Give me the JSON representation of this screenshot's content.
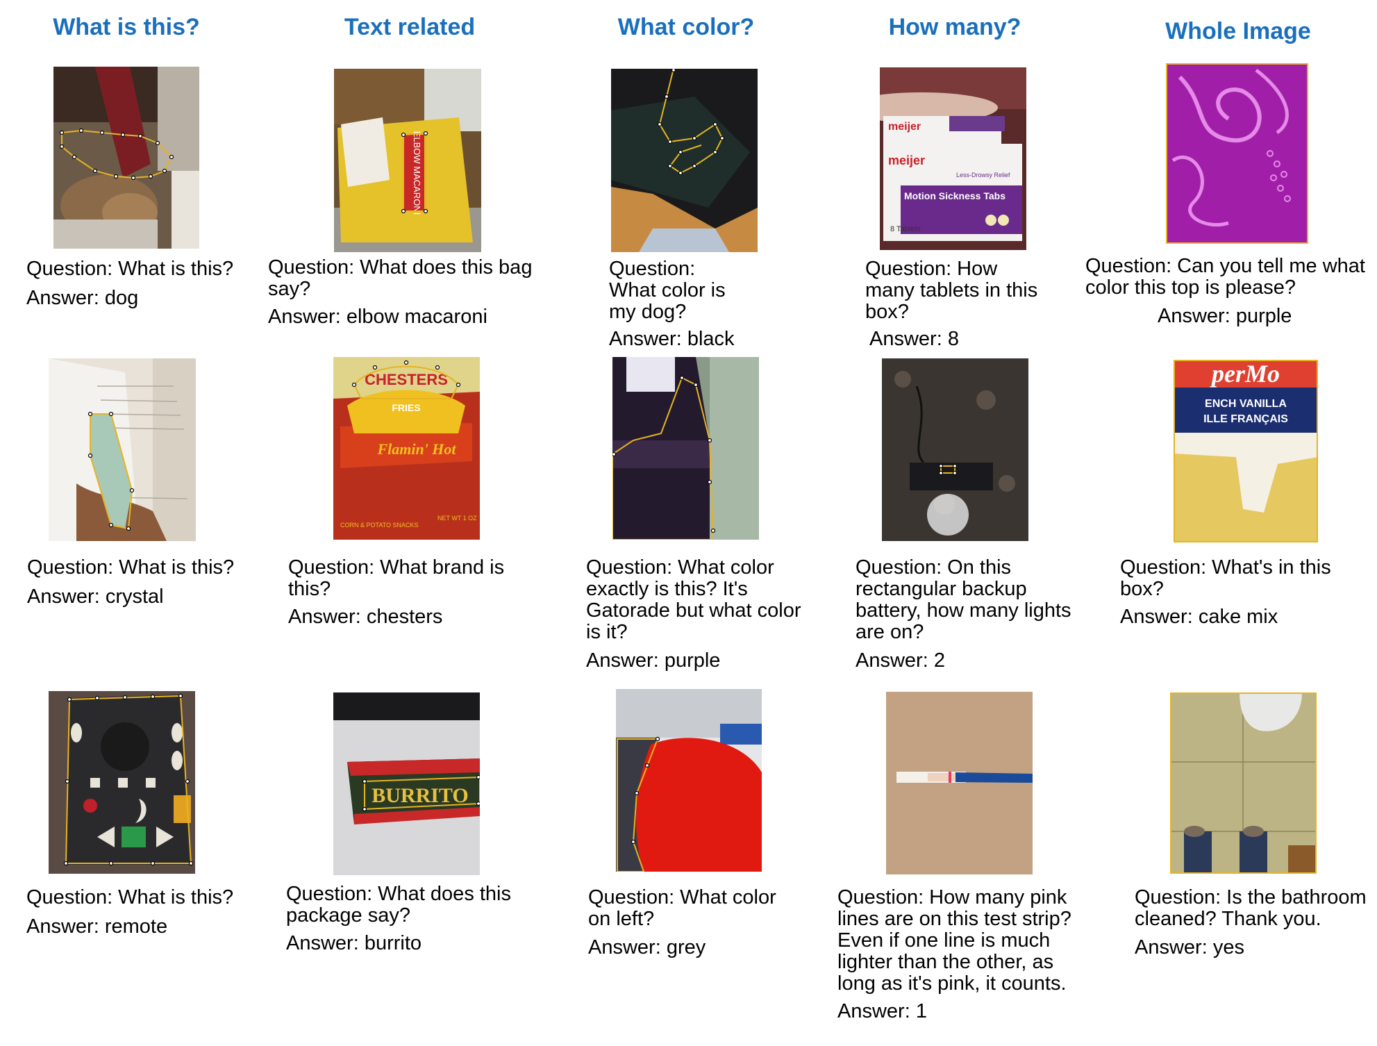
{
  "headers": {
    "col1": "What is this?",
    "col2": "Text related",
    "col3": "What color?",
    "col4": "How many?",
    "col5": "Whole Image"
  },
  "examples": {
    "r1c1": {
      "question": "Question: What is this?",
      "answer": "Answer: dog",
      "photo": "dog-under-curtain"
    },
    "r1c2": {
      "question": "Question: What does this bag\nsay?",
      "answer": "Answer: elbow macaroni",
      "photo": "macaroni-bag",
      "photo_text": [
        "ELBOW MACARONI"
      ]
    },
    "r1c3": {
      "question": "Question:\nWhat color is\nmy dog?",
      "answer": "Answer: black",
      "photo": "black-dog"
    },
    "r1c4": {
      "question": "Question: How\nmany tablets in this\nbox?",
      "answer": "Answer: 8",
      "photo": "meijer-box",
      "photo_text": [
        "meijer",
        "meijer",
        "Motion Sickness Tabs",
        "Less-Drowsy Relief",
        "8 Tablets"
      ]
    },
    "r1c5": {
      "question": "Question: Can you tell me what\ncolor this top is please?",
      "answer": "Answer: purple",
      "photo": "purple-top"
    },
    "r2c1": {
      "question": "Question: What is this?",
      "answer": "Answer: crystal",
      "photo": "crystal-on-book"
    },
    "r2c2": {
      "question": "Question: What brand is\nthis?",
      "answer": "Answer: chesters",
      "photo": "chesters-bag",
      "photo_text": [
        "CHESTERS",
        "FRIES",
        "Flamin' Hot",
        "CORN & POTATO SNACKS",
        "NET WT 1 OZ"
      ]
    },
    "r2c3": {
      "question": "Question: What color\nexactly is this? It's\nGatorade but what color\nis it?",
      "answer": "Answer: purple",
      "photo": "gatorade-bottle"
    },
    "r2c4": {
      "question": "Question: On this\nrectangular backup\nbattery, how many lights\nare on?",
      "answer": "Answer: 2",
      "photo": "backup-battery"
    },
    "r2c5": {
      "question": "Question: What's in this\nbox?",
      "answer": "Answer: cake mix",
      "photo": "cake-mix-box",
      "photo_text": [
        "perMo",
        "ENCH VANILLA",
        "ILLE FRANÇAIS"
      ]
    },
    "r3c1": {
      "question": "Question: What is this?",
      "answer": "Answer: remote",
      "photo": "remote"
    },
    "r3c2": {
      "question": "Question: What does this\npackage say?",
      "answer": "Answer: burrito",
      "photo": "burrito-package",
      "photo_text": [
        "BURRITO"
      ]
    },
    "r3c3": {
      "question": "Question: What color\non left?",
      "answer": "Answer: grey",
      "photo": "red-cloth"
    },
    "r3c4": {
      "question": "Question: How many pink\nlines are on this test strip?\nEven if one line is much\nlighter than the other, as\nlong as it's pink, it counts.",
      "answer": "Answer: 1",
      "photo": "test-strip"
    },
    "r3c5": {
      "question": "Question: Is the bathroom\ncleaned? Thank you.",
      "answer": "Answer: yes",
      "photo": "bathroom-floor"
    }
  },
  "colors": {
    "header": "#1a6fbd",
    "outline": "#e6b422"
  }
}
